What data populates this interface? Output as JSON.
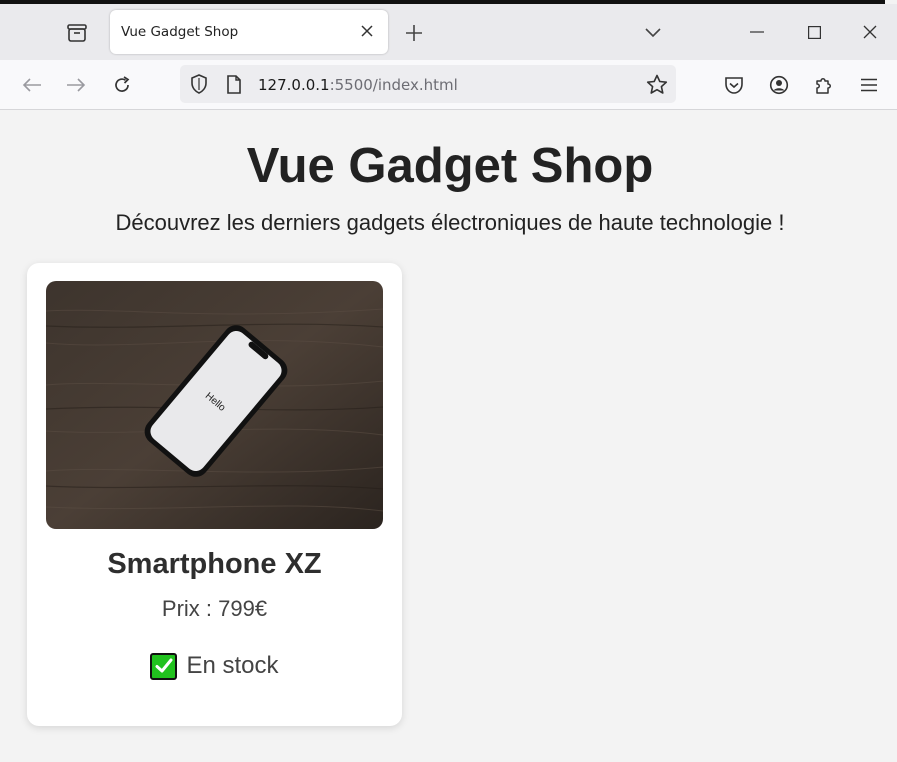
{
  "browser": {
    "tab_title": "Vue Gadget Shop",
    "url_host": "127.0.0.1",
    "url_rest": ":5500/index.html"
  },
  "page": {
    "title": "Vue Gadget Shop",
    "subtitle": "Découvrez les derniers gadgets électroniques de haute technologie !"
  },
  "product": {
    "name": "Smartphone XZ",
    "price": "Prix : 799€",
    "stock_label": "En stock",
    "screen_text": "Hello"
  },
  "icons": {
    "tab_manager": "tab-manager-icon",
    "close": "close-icon",
    "new_tab": "plus-icon",
    "tab_list": "chevron-down-icon",
    "back": "arrow-left-icon",
    "forward": "arrow-right-icon",
    "reload": "reload-icon",
    "shield": "shield-icon",
    "page": "page-icon",
    "star": "star-icon",
    "pocket": "pocket-icon",
    "account": "account-icon",
    "extensions": "puzzle-icon",
    "menu": "hamburger-menu-icon",
    "stock": "check-mark-icon"
  },
  "colors": {
    "stock_check": "#21c21e"
  }
}
